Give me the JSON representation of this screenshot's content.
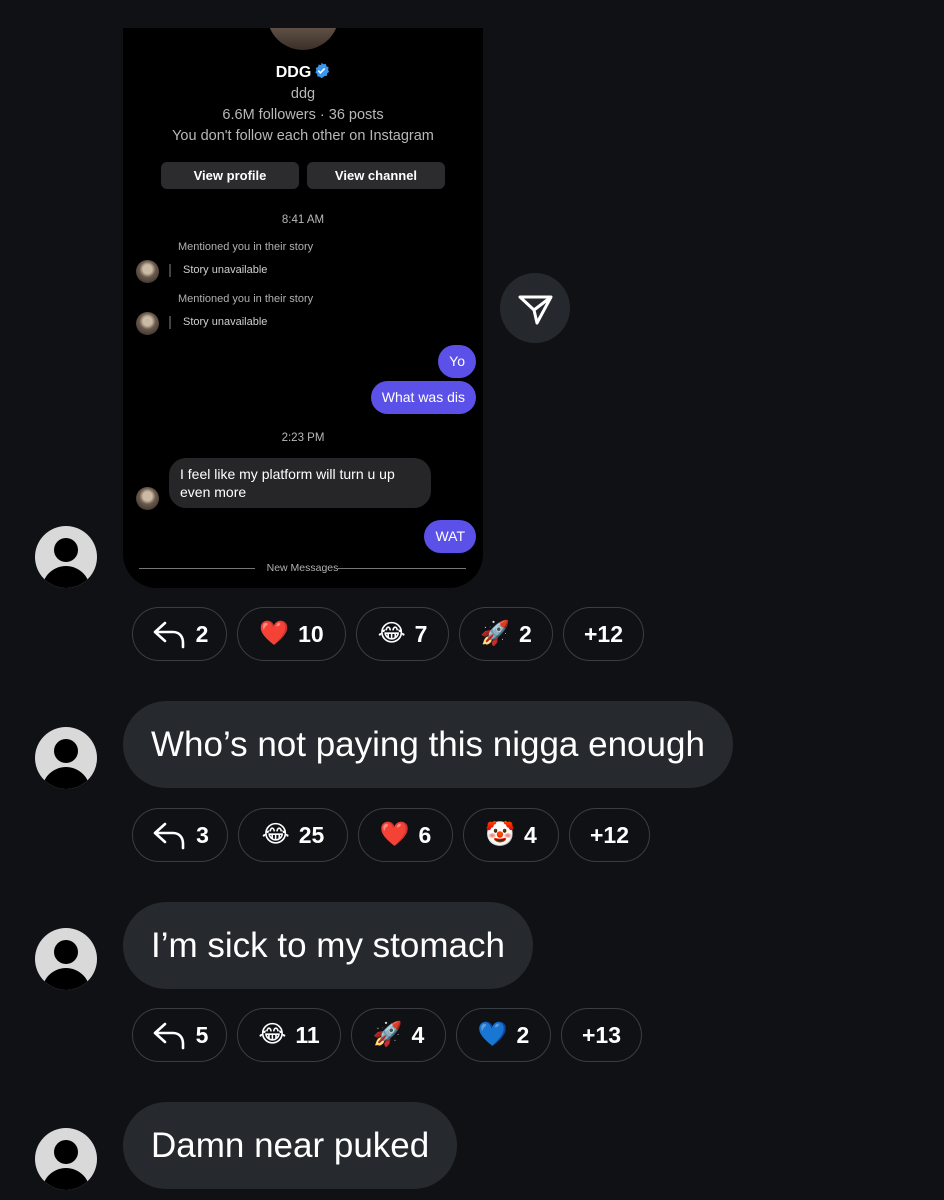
{
  "screenshot": {
    "profile": {
      "name": "DDG",
      "handle": "ddg",
      "stats": "6.6M followers · 36 posts",
      "follow_note": "You don't follow each other on Instagram",
      "view_profile": "View profile",
      "view_channel": "View channel"
    },
    "thread": {
      "time1": "8:41 AM",
      "mention1": "Mentioned you in their story",
      "story1": "Story unavailable",
      "mention2": "Mentioned you in their story",
      "story2": "Story unavailable",
      "out1": "Yo",
      "out2": "What was dis",
      "time2": "2:23 PM",
      "in1": "I feel like my platform will turn u up even more",
      "out3": "WAT",
      "new_messages": "New Messages"
    }
  },
  "posts": [
    {
      "text": "",
      "reactions": [
        {
          "emoji": "reply-icon",
          "count": "2"
        },
        {
          "emoji": "❤️",
          "count": "10"
        },
        {
          "emoji": "😂",
          "count": "7"
        },
        {
          "emoji": "🚀",
          "count": "2"
        },
        {
          "emoji": "",
          "count": "+12"
        }
      ]
    },
    {
      "text": "Who’s not paying this nigga enough",
      "reactions": [
        {
          "emoji": "reply-icon",
          "count": "3"
        },
        {
          "emoji": "😂",
          "count": "25"
        },
        {
          "emoji": "❤️",
          "count": "6"
        },
        {
          "emoji": "🤡",
          "count": "4"
        },
        {
          "emoji": "",
          "count": "+12"
        }
      ]
    },
    {
      "text": "I’m sick to my stomach",
      "reactions": [
        {
          "emoji": "reply-icon",
          "count": "5"
        },
        {
          "emoji": "😂",
          "count": "11"
        },
        {
          "emoji": "🚀",
          "count": "4"
        },
        {
          "emoji": "💙",
          "count": "2"
        },
        {
          "emoji": "",
          "count": "+13"
        }
      ]
    },
    {
      "text": "Damn near puked"
    }
  ],
  "colors": {
    "background": "#0f1115",
    "bubble": "#26292e",
    "outgoing": "#5b51e8"
  }
}
